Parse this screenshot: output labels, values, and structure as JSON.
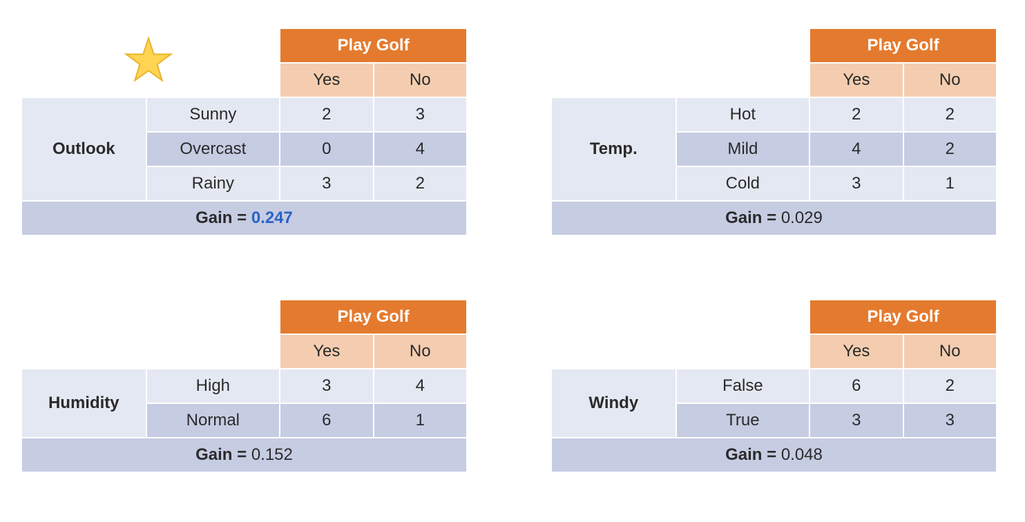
{
  "tables": [
    {
      "attribute": "Outlook",
      "header": "Play Golf",
      "yes_label": "Yes",
      "no_label": "No",
      "starred": true,
      "rows": [
        {
          "cat": "Sunny",
          "yes": "2",
          "no": "3",
          "shade": "light"
        },
        {
          "cat": "Overcast",
          "yes": "0",
          "no": "4",
          "shade": "mid"
        },
        {
          "cat": "Rainy",
          "yes": "3",
          "no": "2",
          "shade": "light"
        }
      ],
      "gain_label": "Gain = ",
      "gain_value": "0.247",
      "gain_highlight": true
    },
    {
      "attribute": "Temp.",
      "header": "Play Golf",
      "yes_label": "Yes",
      "no_label": "No",
      "starred": false,
      "rows": [
        {
          "cat": "Hot",
          "yes": "2",
          "no": "2",
          "shade": "light"
        },
        {
          "cat": "Mild",
          "yes": "4",
          "no": "2",
          "shade": "mid"
        },
        {
          "cat": "Cold",
          "yes": "3",
          "no": "1",
          "shade": "light"
        }
      ],
      "gain_label": "Gain = ",
      "gain_value": "0.029",
      "gain_highlight": false
    },
    {
      "attribute": "Humidity",
      "header": "Play Golf",
      "yes_label": "Yes",
      "no_label": "No",
      "starred": false,
      "rows": [
        {
          "cat": "High",
          "yes": "3",
          "no": "4",
          "shade": "light"
        },
        {
          "cat": "Normal",
          "yes": "6",
          "no": "1",
          "shade": "mid"
        }
      ],
      "gain_label": "Gain = ",
      "gain_value": "0.152",
      "gain_highlight": false
    },
    {
      "attribute": "Windy",
      "header": "Play Golf",
      "yes_label": "Yes",
      "no_label": "No",
      "starred": false,
      "rows": [
        {
          "cat": "False",
          "yes": "6",
          "no": "2",
          "shade": "light"
        },
        {
          "cat": "True",
          "yes": "3",
          "no": "3",
          "shade": "mid"
        }
      ],
      "gain_label": "Gain = ",
      "gain_value": "0.048",
      "gain_highlight": false
    }
  ]
}
